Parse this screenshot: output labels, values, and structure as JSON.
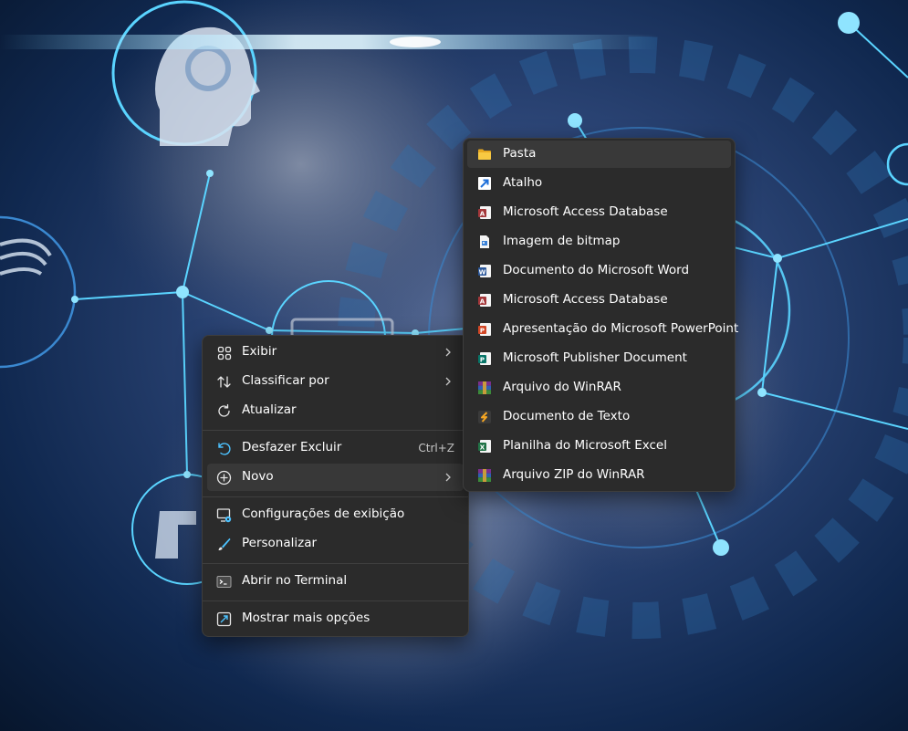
{
  "context_menu": {
    "items": [
      {
        "label": "Exibir",
        "icon": "grid-view-icon",
        "submenu": true
      },
      {
        "label": "Classificar por",
        "icon": "sort-icon",
        "submenu": true
      },
      {
        "label": "Atualizar",
        "icon": "refresh-icon"
      },
      {
        "label": "Desfazer Excluir",
        "icon": "undo-icon",
        "shortcut": "Ctrl+Z"
      },
      {
        "label": "Novo",
        "icon": "add-circle-icon",
        "submenu": true,
        "highlighted": true
      },
      {
        "label": "Configurações de exibição",
        "icon": "display-settings-icon"
      },
      {
        "label": "Personalizar",
        "icon": "brush-icon"
      },
      {
        "label": "Abrir no Terminal",
        "icon": "terminal-icon"
      },
      {
        "label": "Mostrar mais opções",
        "icon": "more-options-icon"
      }
    ]
  },
  "submenu_novo": {
    "items": [
      {
        "label": "Pasta",
        "icon": "folder-icon",
        "highlighted": true
      },
      {
        "label": "Atalho",
        "icon": "shortcut-icon"
      },
      {
        "label": "Microsoft Access Database",
        "icon": "access-icon"
      },
      {
        "label": "Imagem de bitmap",
        "icon": "bitmap-icon"
      },
      {
        "label": "Documento do Microsoft Word",
        "icon": "word-icon"
      },
      {
        "label": "Microsoft Access Database",
        "icon": "access-icon"
      },
      {
        "label": "Apresentação do Microsoft PowerPoint",
        "icon": "powerpoint-icon"
      },
      {
        "label": "Microsoft Publisher Document",
        "icon": "publisher-icon"
      },
      {
        "label": "Arquivo do WinRAR",
        "icon": "winrar-icon"
      },
      {
        "label": "Documento de Texto",
        "icon": "text-document-icon"
      },
      {
        "label": "Planilha do Microsoft Excel",
        "icon": "excel-icon"
      },
      {
        "label": "Arquivo ZIP do WinRAR",
        "icon": "winrar-zip-icon"
      }
    ]
  },
  "colors": {
    "menu_bg": "#2b2b2b",
    "highlight": "#383838",
    "text": "#ffffff",
    "accent": "#4cc2ff",
    "folder": "#f5c242",
    "word": "#2b579a",
    "excel": "#217346",
    "powerpoint": "#d24726",
    "access": "#a4373a",
    "publisher": "#077568",
    "winrar": "#7a2e8c"
  }
}
